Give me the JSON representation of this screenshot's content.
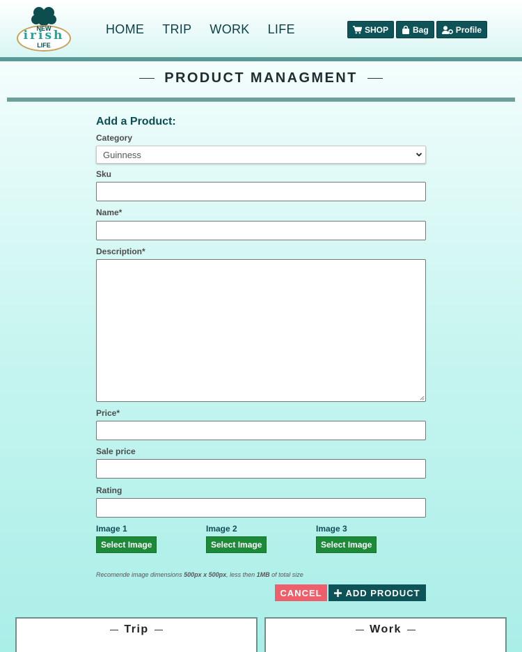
{
  "brand": {
    "line1": "NEW",
    "line2": "irish",
    "line3": "LIFE"
  },
  "nav": {
    "items": [
      "HOME",
      "TRIP",
      "WORK",
      "LIFE"
    ]
  },
  "header_buttons": {
    "shop": "SHOP",
    "bag": "Bag",
    "profile": "Profile"
  },
  "page": {
    "title": "PRODUCT MANAGMENT"
  },
  "form": {
    "heading": "Add a Product:",
    "category_label": "Category",
    "category_value": "Guinness",
    "sku_label": "Sku",
    "name_label": "Name*",
    "description_label": "Description*",
    "price_label": "Price*",
    "sale_price_label": "Sale price",
    "rating_label": "Rating",
    "images": [
      {
        "label": "Image 1",
        "button": "Select Image"
      },
      {
        "label": "Image 2",
        "button": "Select Image"
      },
      {
        "label": "Image 3",
        "button": "Select Image"
      }
    ],
    "hint": {
      "prefix": "Recomende image dimensions ",
      "dims": "500px x 500px",
      "middle": ", less then ",
      "size": "1MB",
      "suffix": " of total size"
    },
    "cancel": "CANCEL",
    "add": "ADD PRODUCT"
  },
  "cards": {
    "trip": "Trip",
    "work": "Work"
  },
  "colors": {
    "accent": "#0d5357",
    "danger": "#ee5f6b",
    "select": "#1d8a3a"
  }
}
